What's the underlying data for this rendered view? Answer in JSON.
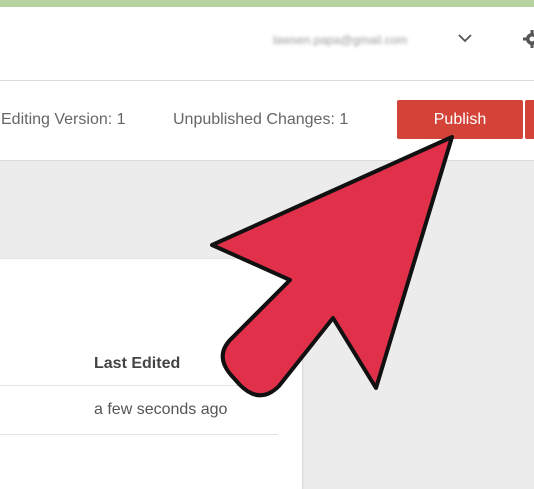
{
  "header": {
    "email": "lawsen.papa@gmail.com",
    "icons": {
      "menu": "chevron-down-icon",
      "settings": "gear-icon"
    }
  },
  "toolbar": {
    "editing_version": "Editing Version: 1",
    "unpublished_changes": "Unpublished Changes: 1",
    "publish_label": "Publish"
  },
  "table": {
    "column_header": "Last Edited",
    "rows": [
      {
        "last_edited": "a few seconds ago"
      }
    ]
  },
  "colors": {
    "accent": "#d44337",
    "arrow_fill": "#e0304a",
    "top_strip": "#b8d3a2",
    "background": "#ececec"
  }
}
